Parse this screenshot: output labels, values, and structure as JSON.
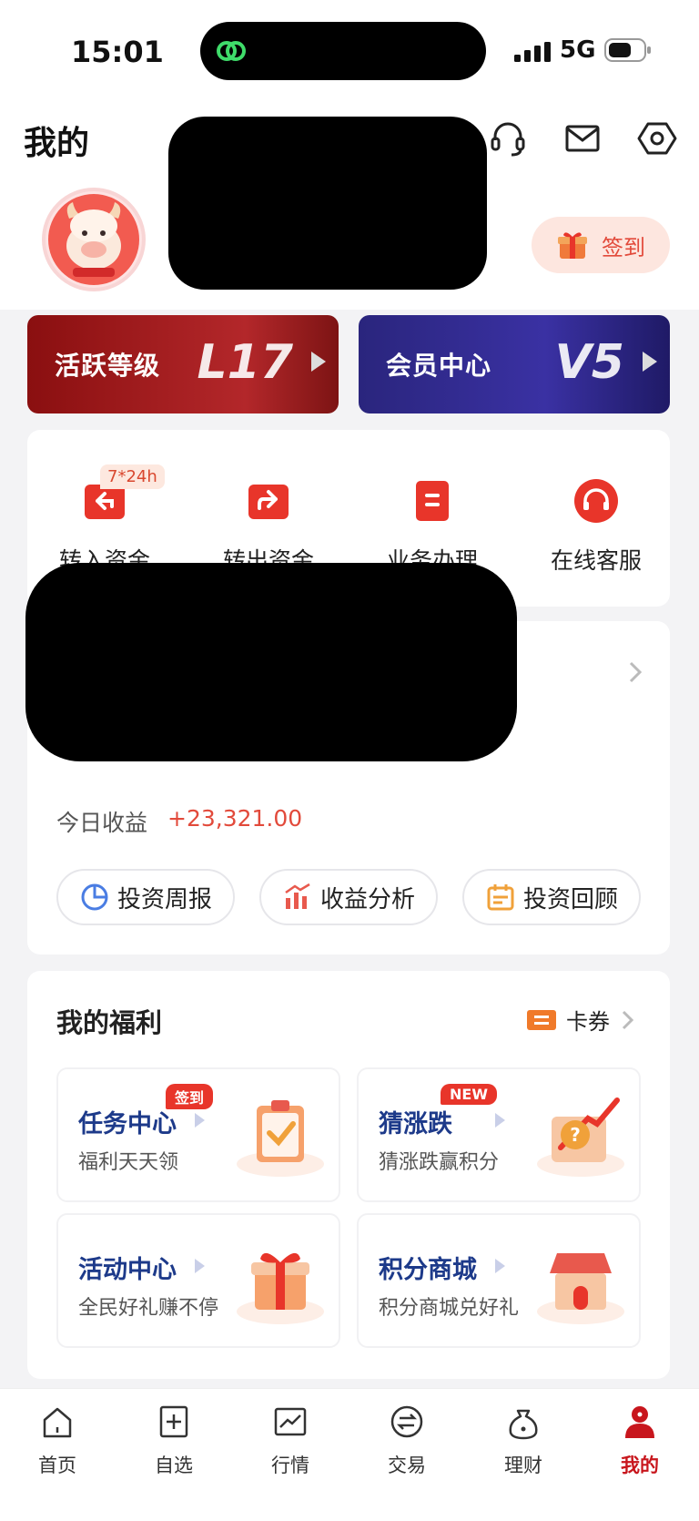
{
  "status_bar": {
    "time": "15:01",
    "network": "5G"
  },
  "header": {
    "title": "我的"
  },
  "profile": {
    "checkin_label": "签到"
  },
  "level_cards": [
    {
      "label": "活跃等级",
      "value": "L17"
    },
    {
      "label": "会员中心",
      "value": "V5"
    }
  ],
  "quick_actions": {
    "badge": "7*24h",
    "items": [
      {
        "label": "转入资金",
        "icon": "transfer-in-icon"
      },
      {
        "label": "转出资金",
        "icon": "transfer-out-icon"
      },
      {
        "label": "业务办理",
        "icon": "business-icon"
      },
      {
        "label": "在线客服",
        "icon": "online-service-icon"
      }
    ]
  },
  "assets": {
    "today_label": "今日收益",
    "today_value": "+23,321.00",
    "pills": [
      {
        "label": "投资周报",
        "icon": "pie-chart-icon"
      },
      {
        "label": "收益分析",
        "icon": "bar-chart-icon"
      },
      {
        "label": "投资回顾",
        "icon": "calendar-icon"
      }
    ]
  },
  "welfare": {
    "title": "我的福利",
    "coupon_label": "卡券",
    "tiles": [
      {
        "title": "任务中心",
        "subtitle": "福利天天领",
        "tag": "签到"
      },
      {
        "title": "猜涨跌",
        "subtitle": "猜涨跌赢积分",
        "tag": "NEW"
      },
      {
        "title": "活动中心",
        "subtitle": "全民好礼赚不停",
        "tag": ""
      },
      {
        "title": "积分商城",
        "subtitle": "积分商城兑好礼",
        "tag": ""
      }
    ]
  },
  "tabbar": {
    "items": [
      {
        "label": "首页",
        "icon": "home-icon"
      },
      {
        "label": "自选",
        "icon": "add-watchlist-icon"
      },
      {
        "label": "行情",
        "icon": "market-chart-icon"
      },
      {
        "label": "交易",
        "icon": "trade-icon"
      },
      {
        "label": "理财",
        "icon": "wealth-bag-icon"
      },
      {
        "label": "我的",
        "icon": "profile-icon"
      }
    ],
    "active_color": "#c8161d"
  },
  "colors": {
    "accent_red": "#e24a3b",
    "member_blue": "#2f2a8f",
    "level_red": "#9b1b1d"
  }
}
